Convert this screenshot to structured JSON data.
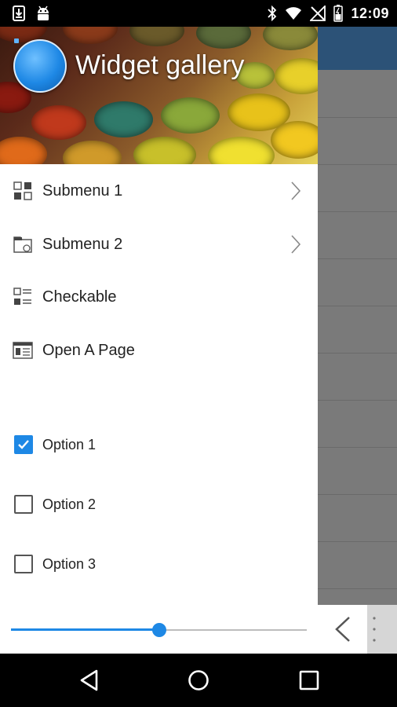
{
  "status_bar": {
    "time": "12:09",
    "left_icons": [
      "download-icon",
      "android-icon"
    ],
    "right_icons": [
      "bluetooth-icon",
      "wifi-icon",
      "no-signal-icon",
      "battery-icon"
    ]
  },
  "drawer": {
    "header": {
      "title": "Widget gallery",
      "avatar": "app-logo"
    },
    "menu": [
      {
        "label": "Submenu 1",
        "icon": "grid-icon",
        "has_submenu": true
      },
      {
        "label": "Submenu 2",
        "icon": "folder-icon",
        "has_submenu": true
      },
      {
        "label": "Checkable",
        "icon": "list-icon",
        "has_submenu": false
      },
      {
        "label": "Open A Page",
        "icon": "page-icon",
        "has_submenu": false
      }
    ],
    "options": [
      {
        "label": "Option 1",
        "checked": true
      },
      {
        "label": "Option 2",
        "checked": false
      },
      {
        "label": "Option 3",
        "checked": false
      }
    ],
    "slider": {
      "value": 0.5
    },
    "accent_color": "#1e88e5"
  },
  "toolbar": {
    "back_icon": "chevron-left-icon",
    "overflow_icon": "more-vert-icon"
  },
  "navbar": {
    "icons": [
      "back-triangle-icon",
      "home-circle-icon",
      "recents-square-icon"
    ]
  }
}
